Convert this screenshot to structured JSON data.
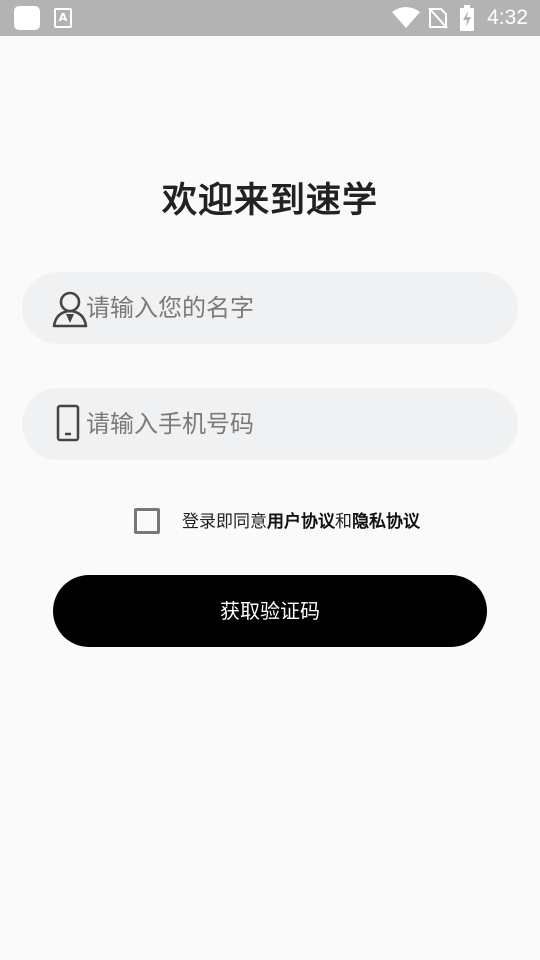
{
  "status_bar": {
    "time": "4:32",
    "left_icons": [
      "app-icon",
      "font-a-icon"
    ],
    "right_icons": [
      "wifi-icon",
      "no-sim-icon",
      "battery-charging-icon"
    ]
  },
  "page": {
    "title": "欢迎来到速学"
  },
  "form": {
    "name": {
      "placeholder": "请输入您的名字",
      "icon": "user-icon"
    },
    "phone": {
      "placeholder": "请输入手机号码",
      "icon": "phone-icon"
    },
    "agreement": {
      "checked": false,
      "prefix": "登录即同意",
      "user_agreement": "用户协议",
      "conjunction": "和",
      "privacy_agreement": "隐私协议"
    },
    "submit_label": "获取验证码"
  },
  "colors": {
    "background": "#fafafa",
    "status_bar": "#b3b3b3",
    "field_bg": "#f0f1f3",
    "button_bg": "#000000",
    "title": "#222222"
  }
}
